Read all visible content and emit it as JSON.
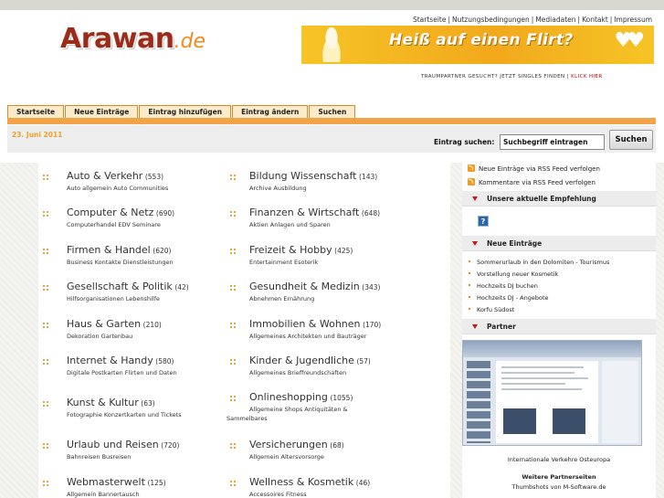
{
  "site": {
    "logo_main": "Arawan",
    "logo_suffix": ".de"
  },
  "toplinks": [
    "Startseite",
    "Nutzungsbedingungen",
    "Mediadaten",
    "Kontakt",
    "Impressum"
  ],
  "banner": {
    "title": "Heiß auf einen Flirt?",
    "sub": "TRAUMPARTNER GESUCHT? JETZT SINGLES FINDEN |",
    "sub_link": "KLICK HIER"
  },
  "nav": [
    "Startseite",
    "Neue Einträge",
    "Eintrag hinzufügen",
    "Eintrag ändern",
    "Suchen"
  ],
  "date": "23. Juni 2011",
  "search": {
    "label": "Eintrag suchen:",
    "value": "Suchbegriff eintragen",
    "button": "Suchen"
  },
  "categories": [
    {
      "name": "Auto & Verkehr",
      "count": "(553)",
      "sub": "Auto allgemein Auto Communities"
    },
    {
      "name": "Bildung Wissenschaft",
      "count": "(143)",
      "sub": "Archive Ausbildung"
    },
    {
      "name": "Computer & Netz",
      "count": "(690)",
      "sub": "Computerhandel EDV Seminare"
    },
    {
      "name": "Finanzen & Wirtschaft",
      "count": "(648)",
      "sub": "Aktien Anlagen und Sparen"
    },
    {
      "name": "Firmen & Handel",
      "count": "(620)",
      "sub": "Business Kontakte Dienstleistungen"
    },
    {
      "name": "Freizeit & Hobby",
      "count": "(425)",
      "sub": "Entertainment Esoterik"
    },
    {
      "name": "Gesellschaft & Politik",
      "count": "(42)",
      "sub": "Hilfsorganisationen Lebenshilfe"
    },
    {
      "name": "Gesundheit & Medizin",
      "count": "(343)",
      "sub": "Abnehmen Ernährung"
    },
    {
      "name": "Haus & Garten",
      "count": "(210)",
      "sub": "Dekoration Gartenbau"
    },
    {
      "name": "Immobilien & Wohnen",
      "count": "(170)",
      "sub": "Allgemeines Architekten und Bauträger"
    },
    {
      "name": "Internet & Handy",
      "count": "(580)",
      "sub": "Digitale Postkarten Flirten und Daten"
    },
    {
      "name": "Kinder & Jugendliche",
      "count": "(57)",
      "sub": "Allgemeines Brieffreundschaften"
    },
    {
      "name": "Kunst & Kultur",
      "count": "(63)",
      "sub": "Fotographie Konzertkarten und Tickets"
    },
    {
      "name": "Onlineshopping",
      "count": "(1055)",
      "sub": "Allgemeine Shops Antiquitäten & Sammelbares"
    },
    {
      "name": "Urlaub und Reisen",
      "count": "(720)",
      "sub": "Bahnreisen Busreisen"
    },
    {
      "name": "Versicherungen",
      "count": "(68)",
      "sub": "Allgemein Altersvorsorge"
    },
    {
      "name": "Webmasterwelt",
      "count": "(125)",
      "sub": "Allgemein Bannertausch"
    },
    {
      "name": "Wellness & Kosmetik",
      "count": "(46)",
      "sub": "Accessoires Fitness"
    }
  ],
  "sidebar": {
    "rss": [
      "Neue Einträge via RSS Feed verfolgen",
      "Kommentare via RSS Feed verfolgen"
    ],
    "recommend_title": "Unsere aktuelle Empfehlung",
    "new_title": "Neue Einträge",
    "new_items": [
      "Sommerurlaub in den Dolomiten - Tourismus",
      "Vorstellung neuer Kosmetik",
      "Hochzeits DJ buchen",
      "Hochzeits DJ - Angebote",
      "Korfu Südost"
    ],
    "partner_title": "Partner",
    "partner_caption": "Internationale Verkehre Osteuropa",
    "partner_more": "Weitere Partnerseiten",
    "thumbshots": "Thumbshots von M-Software.de"
  },
  "colors": {
    "accent": "#f3a347",
    "logo": "#9c2c1a",
    "banner": "#f6c426",
    "triangle": "#c41a1a"
  },
  "icons": {
    "rss": "rss-icon",
    "section": "triangle-down-icon",
    "bullet": "dots-bullet-icon",
    "empfehlung": "question-icon"
  }
}
